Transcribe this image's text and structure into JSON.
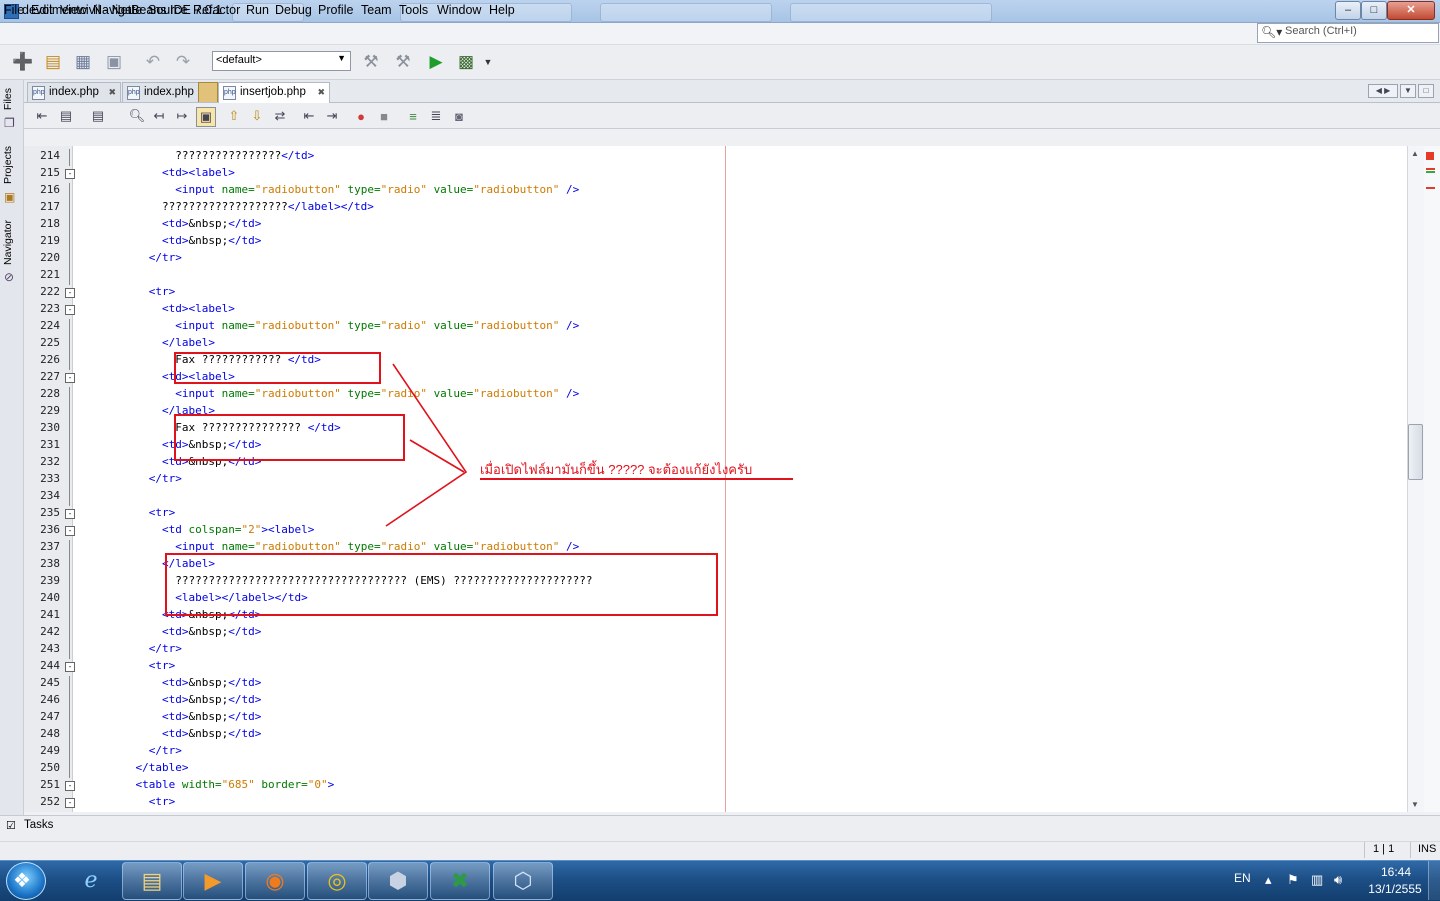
{
  "window": {
    "title": "devolmentcivil - NetBeans IDE 7.0.1",
    "controls": [
      "–",
      "□",
      "✕"
    ]
  },
  "menu": [
    "File",
    "Edit",
    "View",
    "Navigate",
    "Source",
    "Refactor",
    "Run",
    "Debug",
    "Profile",
    "Team",
    "Tools",
    "Window",
    "Help"
  ],
  "search": {
    "placeholder": "Search (Ctrl+I)"
  },
  "toolbar": {
    "config_value": "<default>"
  },
  "side_panels": [
    "Files",
    "Projects",
    "Navigator"
  ],
  "tabs": [
    {
      "label": "index.php",
      "active": false
    },
    {
      "label": "index.php",
      "active": false
    },
    {
      "label": "insertjob.php",
      "active": true
    }
  ],
  "code_lines": [
    {
      "n": "214",
      "fold": "",
      "html": "          ????????????????<span class=\"t\">&lt;/td&gt;</span>"
    },
    {
      "n": "215",
      "fold": "-",
      "html": "        <span class=\"t\">&lt;td&gt;&lt;label&gt;</span>"
    },
    {
      "n": "216",
      "fold": "",
      "html": "          <span class=\"t\">&lt;input</span> <span class=\"a\">name=</span><span class=\"v\">\"radiobutton\"</span> <span class=\"a\">type=</span><span class=\"v\">\"radio\"</span> <span class=\"a\">value=</span><span class=\"v\">\"radiobutton\"</span> <span class=\"t\">/&gt;</span>"
    },
    {
      "n": "217",
      "fold": "",
      "html": "        ???????????????????<span class=\"t\">&lt;/label&gt;&lt;/td&gt;</span>"
    },
    {
      "n": "218",
      "fold": "",
      "html": "        <span class=\"t\">&lt;td&gt;</span>&amp;nbsp;<span class=\"t\">&lt;/td&gt;</span>"
    },
    {
      "n": "219",
      "fold": "",
      "html": "        <span class=\"t\">&lt;td&gt;</span>&amp;nbsp;<span class=\"t\">&lt;/td&gt;</span>"
    },
    {
      "n": "220",
      "fold": "",
      "html": "      <span class=\"t\">&lt;/tr&gt;</span>"
    },
    {
      "n": "221",
      "fold": "",
      "html": ""
    },
    {
      "n": "222",
      "fold": "-",
      "html": "      <span class=\"t\">&lt;tr&gt;</span>"
    },
    {
      "n": "223",
      "fold": "-",
      "html": "        <span class=\"t\">&lt;td&gt;&lt;label&gt;</span>"
    },
    {
      "n": "224",
      "fold": "",
      "html": "          <span class=\"t\">&lt;input</span> <span class=\"a\">name=</span><span class=\"v\">\"radiobutton\"</span> <span class=\"a\">type=</span><span class=\"v\">\"radio\"</span> <span class=\"a\">value=</span><span class=\"v\">\"radiobutton\"</span> <span class=\"t\">/&gt;</span>"
    },
    {
      "n": "225",
      "fold": "",
      "html": "        <span class=\"t\">&lt;/label&gt;</span>"
    },
    {
      "n": "226",
      "fold": "",
      "html": "          Fax ???????????? <span class=\"t\">&lt;/td&gt;</span>"
    },
    {
      "n": "227",
      "fold": "-",
      "html": "        <span class=\"t\">&lt;td&gt;&lt;label&gt;</span>"
    },
    {
      "n": "228",
      "fold": "",
      "html": "          <span class=\"t\">&lt;input</span> <span class=\"a\">name=</span><span class=\"v\">\"radiobutton\"</span> <span class=\"a\">type=</span><span class=\"v\">\"radio\"</span> <span class=\"a\">value=</span><span class=\"v\">\"radiobutton\"</span> <span class=\"t\">/&gt;</span>"
    },
    {
      "n": "229",
      "fold": "",
      "html": "        <span class=\"t\">&lt;/label&gt;</span>"
    },
    {
      "n": "230",
      "fold": "",
      "html": "          Fax ??????????????? <span class=\"t\">&lt;/td&gt;</span>"
    },
    {
      "n": "231",
      "fold": "",
      "html": "        <span class=\"t\">&lt;td&gt;</span>&amp;nbsp;<span class=\"t\">&lt;/td&gt;</span>"
    },
    {
      "n": "232",
      "fold": "",
      "html": "        <span class=\"t\">&lt;td&gt;</span>&amp;nbsp;<span class=\"t\">&lt;/td&gt;</span>"
    },
    {
      "n": "233",
      "fold": "",
      "html": "      <span class=\"t\">&lt;/tr&gt;</span>"
    },
    {
      "n": "234",
      "fold": "",
      "html": ""
    },
    {
      "n": "235",
      "fold": "-",
      "html": "      <span class=\"t\">&lt;tr&gt;</span>"
    },
    {
      "n": "236",
      "fold": "-",
      "html": "        <span class=\"t\">&lt;td</span> <span class=\"a\">colspan=</span><span class=\"v\">\"2\"</span><span class=\"t\">&gt;&lt;label&gt;</span>"
    },
    {
      "n": "237",
      "fold": "",
      "html": "          <span class=\"t\">&lt;input</span> <span class=\"a\">name=</span><span class=\"v\">\"radiobutton\"</span> <span class=\"a\">type=</span><span class=\"v\">\"radio\"</span> <span class=\"a\">value=</span><span class=\"v\">\"radiobutton\"</span> <span class=\"t\">/&gt;</span>"
    },
    {
      "n": "238",
      "fold": "",
      "html": "        <span class=\"t\">&lt;/label&gt;</span>"
    },
    {
      "n": "239",
      "fold": "",
      "html": "          ??????????????????????????????????? (EMS) ?????????????????????"
    },
    {
      "n": "240",
      "fold": "",
      "html": "          <span class=\"t\">&lt;label&gt;&lt;/label&gt;&lt;/td&gt;</span>"
    },
    {
      "n": "241",
      "fold": "",
      "html": "        <span class=\"t\">&lt;td&gt;</span>&amp;nbsp;<span class=\"t\">&lt;/td&gt;</span>"
    },
    {
      "n": "242",
      "fold": "",
      "html": "        <span class=\"t\">&lt;td&gt;</span>&amp;nbsp;<span class=\"t\">&lt;/td&gt;</span>"
    },
    {
      "n": "243",
      "fold": "",
      "html": "      <span class=\"t\">&lt;/tr&gt;</span>"
    },
    {
      "n": "244",
      "fold": "-",
      "html": "      <span class=\"t\">&lt;tr&gt;</span>"
    },
    {
      "n": "245",
      "fold": "",
      "html": "        <span class=\"t\">&lt;td&gt;</span>&amp;nbsp;<span class=\"t\">&lt;/td&gt;</span>"
    },
    {
      "n": "246",
      "fold": "",
      "html": "        <span class=\"t\">&lt;td&gt;</span>&amp;nbsp;<span class=\"t\">&lt;/td&gt;</span>"
    },
    {
      "n": "247",
      "fold": "",
      "html": "        <span class=\"t\">&lt;td&gt;</span>&amp;nbsp;<span class=\"t\">&lt;/td&gt;</span>"
    },
    {
      "n": "248",
      "fold": "",
      "html": "        <span class=\"t\">&lt;td&gt;</span>&amp;nbsp;<span class=\"t\">&lt;/td&gt;</span>"
    },
    {
      "n": "249",
      "fold": "",
      "html": "      <span class=\"t\">&lt;/tr&gt;</span>"
    },
    {
      "n": "250",
      "fold": "",
      "html": "    <span class=\"t\">&lt;/table&gt;</span>"
    },
    {
      "n": "251",
      "fold": "-",
      "html": "    <span class=\"t\">&lt;table</span> <span class=\"a\">width=</span><span class=\"v\">\"685\"</span> <span class=\"a\">border=</span><span class=\"v\">\"0\"</span><span class=\"t\">&gt;</span>"
    },
    {
      "n": "252",
      "fold": "-",
      "html": "      <span class=\"t\">&lt;tr&gt;</span>"
    }
  ],
  "annotation": {
    "text": "เมื่อเปิดไฟล์มามันก็ขึ้น   ????? จะต้องแก้ยังไงครับ",
    "color": "#e0121c"
  },
  "tasks": {
    "label": "Tasks"
  },
  "status": {
    "caret": "1 | 1",
    "mode": "INS"
  },
  "taskbar": {
    "lang": "EN",
    "time": "16:44",
    "date": "13/1/2555"
  }
}
